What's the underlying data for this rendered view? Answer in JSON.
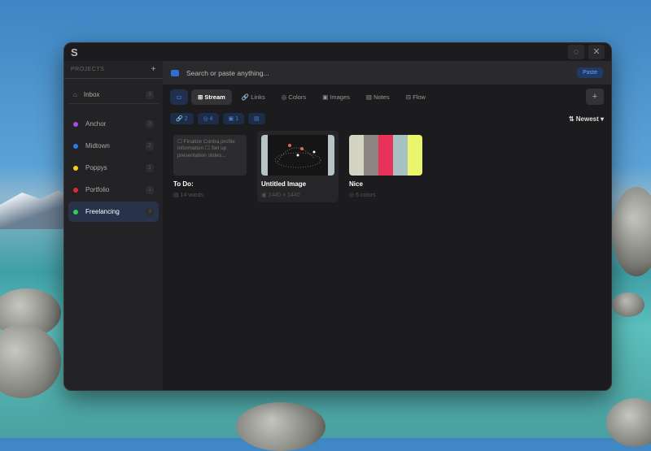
{
  "window": {
    "logo": "S",
    "close": "✕",
    "pin": "◌"
  },
  "sidebar": {
    "header": "PROJECTS",
    "add": "+",
    "inbox": {
      "label": "Inbox",
      "count": "3"
    },
    "projects": [
      {
        "label": "Anchor",
        "count": "3",
        "color": "#a64de0"
      },
      {
        "label": "Midtown",
        "count": "2",
        "color": "#2f7be8"
      },
      {
        "label": "Poppys",
        "count": "1",
        "color": "#f2d21a"
      },
      {
        "label": "Portfolio",
        "count": "1",
        "color": "#e0283c"
      },
      {
        "label": "Freelancing",
        "count": "3",
        "color": "#2fcf5a"
      }
    ]
  },
  "search": {
    "placeholder": "Search or paste anything...",
    "paste": "Paste"
  },
  "tabs": [
    "Stream",
    "Links",
    "Colors",
    "Images",
    "Notes",
    "Flow"
  ],
  "tab_icons": [
    "⊞",
    "🔗",
    "◎",
    "▣",
    "▤",
    "⊟"
  ],
  "filters": [
    {
      "icon": "🔗",
      "count": "2"
    },
    {
      "icon": "◎",
      "count": "4"
    },
    {
      "icon": "▣",
      "count": "1"
    },
    {
      "icon": "▤",
      "count": ""
    }
  ],
  "sort": {
    "icon": "⇅",
    "label": "Newest ▾"
  },
  "cards": [
    {
      "title": "To Do:",
      "meta": "14 words",
      "text": "☐ Finalize Contra profile information ☐ Set up presentation slides..."
    },
    {
      "title": "Untitled Image",
      "meta": "1440 × 1440"
    },
    {
      "title": "Nice",
      "meta": "6 colors",
      "colors": [
        "#d3d4c2",
        "#8a8482",
        "#e8325a",
        "#a7c0c2",
        "#e9f56a"
      ]
    }
  ]
}
